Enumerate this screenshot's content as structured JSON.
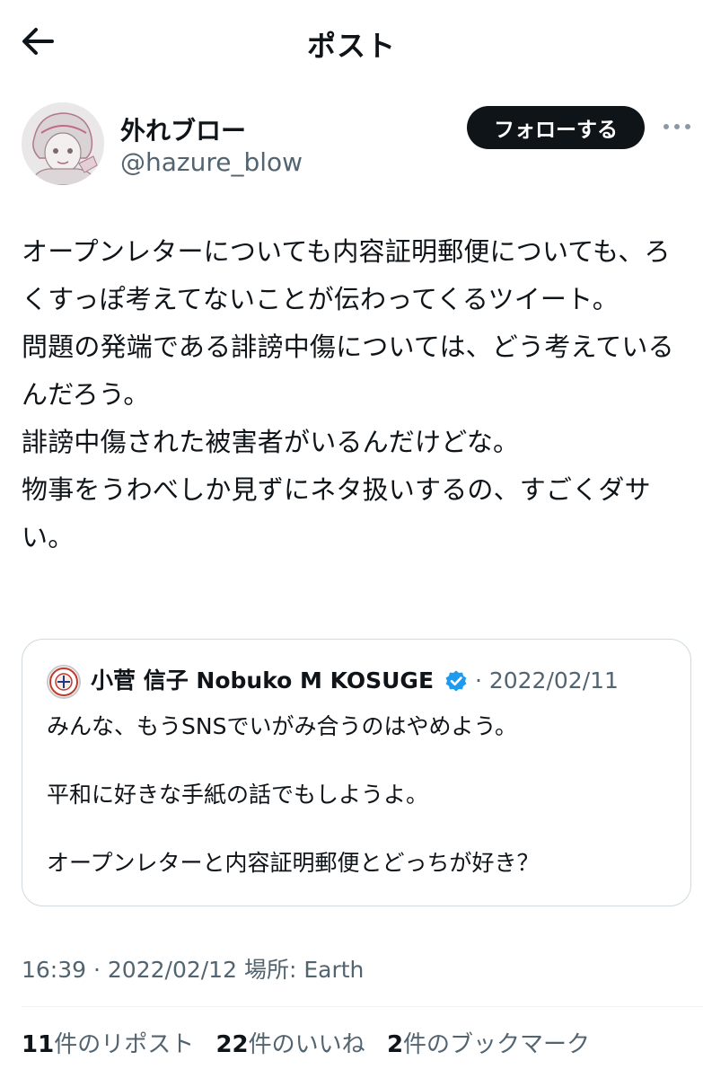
{
  "header": {
    "title": "ポスト"
  },
  "author": {
    "name": "外れブロー",
    "handle": "@hazure_blow",
    "follow_label": "フォローする"
  },
  "tweet": {
    "text": "オープンレターについても内容証明郵便についても、ろくすっぽ考えてないことが伝わってくるツイート。\n問題の発端である誹謗中傷については、どう考えているんだろう。\n誹謗中傷された被害者がいるんだけどな。\n物事をうわべしか見ずにネタ扱いするの、すごくダサい。"
  },
  "quote": {
    "name": "小菅 信子 Nobuko M KOSUGE",
    "date": "2022/02/11",
    "separator": "·",
    "text": "みんな、もうSNSでいがみ合うのはやめよう。\n\n平和に好きな手紙の話でもしようよ。\n\nオープンレターと内容証明郵便とどっちが好き？"
  },
  "meta": {
    "time": "16:39",
    "separator": "·",
    "date": "2022/02/12",
    "place_label": "場所:",
    "place_value": "Earth"
  },
  "stats": {
    "reposts_count": "11",
    "reposts_label": "件のリポスト",
    "likes_count": "22",
    "likes_label": "件のいいね",
    "bookmarks_count": "2",
    "bookmarks_label": "件のブックマーク"
  },
  "colors": {
    "text": "#0f1419",
    "secondary": "#536471",
    "border": "#cfd9de",
    "verified": "#1d9bf0",
    "button_bg": "#0f1419"
  },
  "icons": [
    "arrow-left-icon",
    "more-horizontal-icon",
    "verified-badge-icon"
  ]
}
